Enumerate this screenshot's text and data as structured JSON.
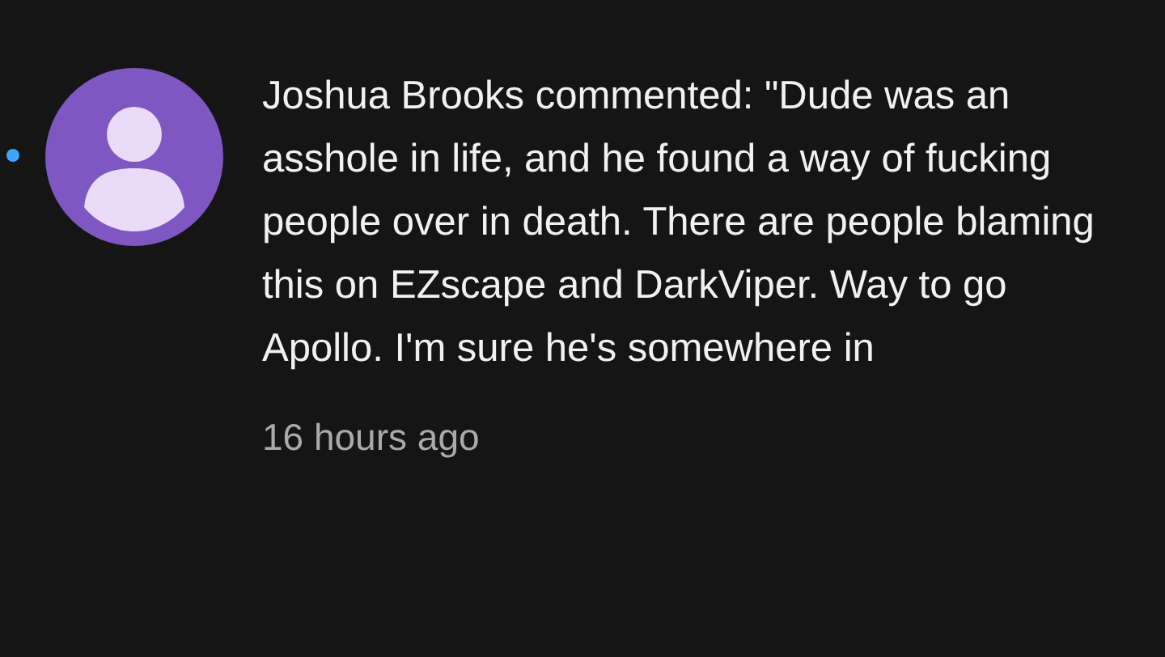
{
  "notification": {
    "unread": true,
    "message": "Joshua Brooks commented: \"Dude was an asshole in life, and he found a way of fucking people over in death. There are people blaming this on EZscape and DarkViper. Way to go Apollo. I'm sure he's somewhere in",
    "time": "16 hours ago"
  }
}
